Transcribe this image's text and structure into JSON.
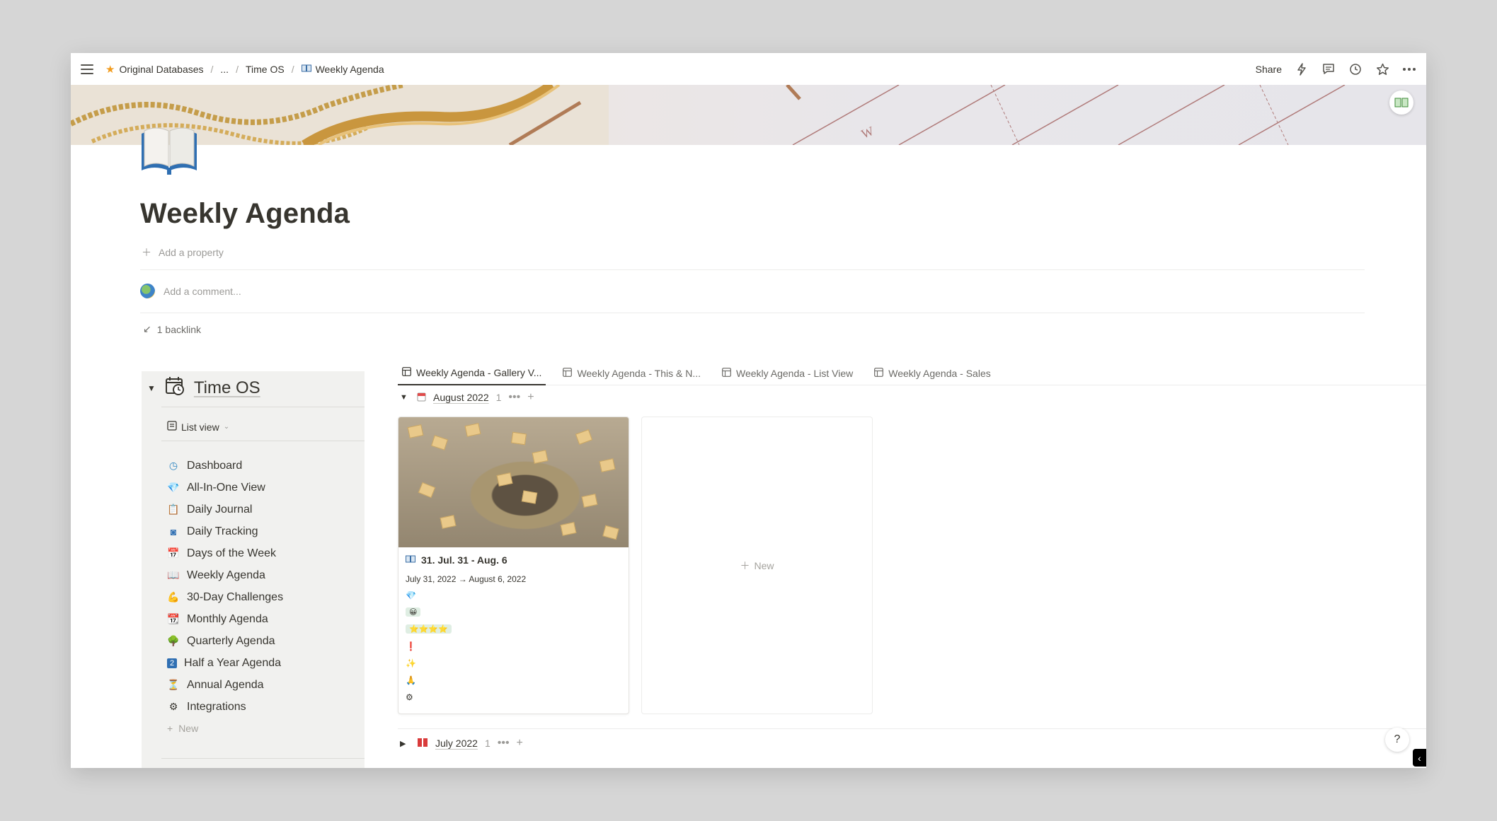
{
  "breadcrumb": {
    "items": [
      {
        "label": "Original Databases",
        "icon": "star-icon"
      },
      {
        "label": "..."
      },
      {
        "label": "Time OS"
      },
      {
        "label": "Weekly Agenda",
        "icon": "open-book-icon"
      }
    ]
  },
  "topbar": {
    "share_label": "Share",
    "icons": [
      "lightning-icon",
      "comment-icon",
      "history-clock-icon",
      "favorite-star-icon",
      "more-dots-icon"
    ]
  },
  "page": {
    "title": "Weekly Agenda",
    "add_property": "Add a property",
    "comment_placeholder": "Add a comment...",
    "backlink": "1 backlink"
  },
  "nav": {
    "title": "Time OS",
    "view_label": "List view",
    "items": [
      {
        "label": "Dashboard",
        "icon": "dashboard-icon",
        "glyph": "◷"
      },
      {
        "label": "All-In-One View",
        "icon": "gem-icon",
        "glyph": "💎"
      },
      {
        "label": "Daily Journal",
        "icon": "clipboard-icon",
        "glyph": "📋"
      },
      {
        "label": "Daily Tracking",
        "icon": "tracking-icon",
        "glyph": "◙"
      },
      {
        "label": "Days of the Week",
        "icon": "calendar-icon",
        "glyph": "📅"
      },
      {
        "label": "Weekly Agenda",
        "icon": "open-book-icon",
        "glyph": "📖"
      },
      {
        "label": "30-Day Challenges",
        "icon": "flexed-arm-icon",
        "glyph": "💪"
      },
      {
        "label": "Monthly Agenda",
        "icon": "tear-off-calendar-icon",
        "glyph": "📆"
      },
      {
        "label": "Quarterly Agenda",
        "icon": "tree-icon",
        "glyph": "🌳"
      },
      {
        "label": "Half a Year Agenda",
        "icon": "number-two-icon",
        "glyph": "2"
      },
      {
        "label": "Annual Agenda",
        "icon": "hourglass-icon",
        "glyph": "⏳"
      },
      {
        "label": "Integrations",
        "icon": "gear-icon",
        "glyph": "⚙"
      }
    ],
    "new_label": "New"
  },
  "tabs": [
    {
      "label": "Weekly Agenda - Gallery V...",
      "active": true
    },
    {
      "label": "Weekly Agenda - This & N...",
      "active": false
    },
    {
      "label": "Weekly Agenda - List View",
      "active": false
    },
    {
      "label": "Weekly Agenda - Sales",
      "active": false
    }
  ],
  "groups": [
    {
      "label": "August 2022",
      "count": "1",
      "expanded": true,
      "icon": "tear-off-calendar-icon"
    },
    {
      "label": "July 2022",
      "count": "1",
      "expanded": false,
      "icon": "red-book-icon"
    }
  ],
  "card": {
    "title": "31. Jul. 31 - Aug. 6",
    "date_range": "July 31, 2022 → August 6, 2022",
    "props": [
      {
        "glyph": "💎",
        "icon": "gem-icon",
        "pill": false
      },
      {
        "glyph": "😀",
        "icon": "smile-icon",
        "pill": true
      },
      {
        "glyph": "⭐⭐⭐⭐",
        "icon": "stars-icon",
        "pill": true
      },
      {
        "glyph": "❗",
        "icon": "exclamation-icon",
        "pill": false
      },
      {
        "glyph": "✨",
        "icon": "sparkles-icon",
        "pill": false
      },
      {
        "glyph": "🙏",
        "icon": "pray-icon",
        "pill": false
      },
      {
        "glyph": "⚙",
        "icon": "gear-icon",
        "pill": false
      }
    ]
  },
  "new_card_label": "New",
  "help_label": "?"
}
